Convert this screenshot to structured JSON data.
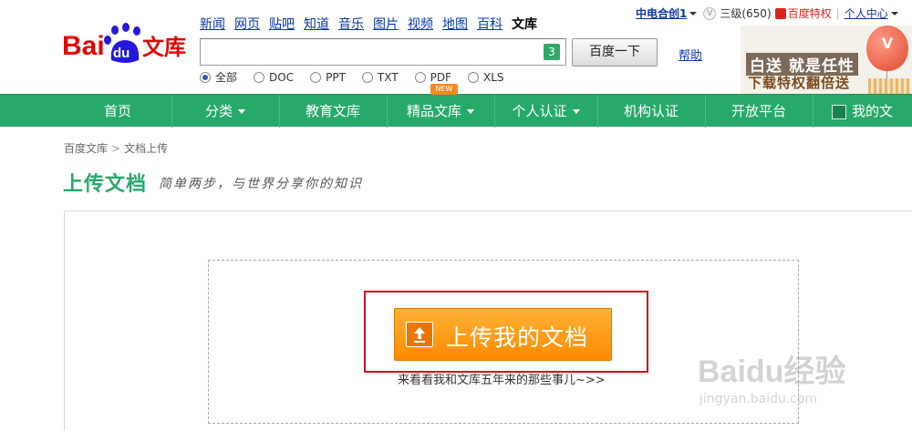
{
  "header": {
    "logo": {
      "brand": "Bai",
      "brand_du": "du",
      "product": "文库"
    },
    "top_nav": [
      {
        "label": "新闻",
        "active": false
      },
      {
        "label": "网页",
        "active": false
      },
      {
        "label": "贴吧",
        "active": false
      },
      {
        "label": "知道",
        "active": false
      },
      {
        "label": "音乐",
        "active": false
      },
      {
        "label": "图片",
        "active": false
      },
      {
        "label": "视频",
        "active": false
      },
      {
        "label": "地图",
        "active": false
      },
      {
        "label": "百科",
        "active": false
      },
      {
        "label": "文库",
        "active": true
      }
    ],
    "search": {
      "value": "",
      "badge": "3",
      "button_label": "百度一下"
    },
    "help_label": "帮助",
    "filters": [
      {
        "label": "全部",
        "checked": true
      },
      {
        "label": "DOC",
        "checked": false
      },
      {
        "label": "PPT",
        "checked": false
      },
      {
        "label": "TXT",
        "checked": false
      },
      {
        "label": "PDF",
        "checked": false
      },
      {
        "label": "XLS",
        "checked": false
      }
    ],
    "user": {
      "name": "中电合创1",
      "level": "三级(650)",
      "privilege": "百度特权",
      "separator": "|",
      "center": "个人中心"
    },
    "promo": {
      "line1": "白送 就是任性",
      "line2": "下载特权翻倍送",
      "balloon": "V"
    }
  },
  "main_nav": {
    "items": [
      {
        "label": "首页",
        "dropdown": false
      },
      {
        "label": "分类",
        "dropdown": true
      },
      {
        "label": "教育文库",
        "dropdown": false
      },
      {
        "label": "精品文库",
        "dropdown": true
      },
      {
        "label": "个人认证",
        "dropdown": true
      },
      {
        "label": "机构认证",
        "dropdown": false
      },
      {
        "label": "开放平台",
        "dropdown": false
      },
      {
        "label": "我的文",
        "dropdown": false
      }
    ],
    "new_badge": "NEW"
  },
  "page": {
    "breadcrumb": [
      "百度文库",
      "文档上传"
    ],
    "breadcrumb_sep": ">",
    "title": "上传文档",
    "subtitle": "简单两步，与世界分享你的知识",
    "upload_button": "上传我的文档",
    "history_link": "来看看我和文库五年来的那些事儿~>>"
  },
  "watermark": {
    "text": "Baidu经验",
    "url": "jingyan.baidu.com"
  },
  "colors": {
    "brand_green": "#27a96a",
    "upload_orange": "#ff9a11",
    "highlight_red": "#c8161e",
    "link_blue": "#0b38a4"
  }
}
